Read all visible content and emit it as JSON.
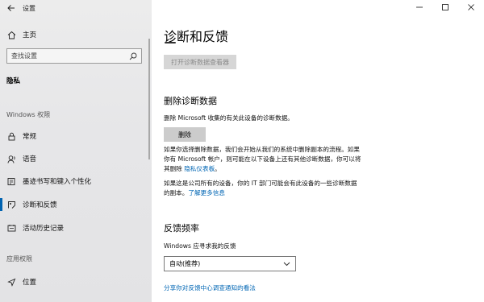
{
  "window": {
    "title": "设置",
    "controls": [
      "minimize",
      "maximize",
      "close"
    ]
  },
  "sidebar": {
    "home_label": "主页",
    "search_placeholder": "查找设置",
    "category_title": "隐私",
    "windows_permissions_label": "Windows 权限",
    "items": [
      {
        "label": "常规",
        "icon": "lock-icon"
      },
      {
        "label": "语音",
        "icon": "speech-icon"
      },
      {
        "label": "墨迹书写和键入个性化",
        "icon": "pen-keyboard-icon"
      },
      {
        "label": "诊断和反馈",
        "icon": "diagnostics-icon",
        "active": true
      },
      {
        "label": "活动历史记录",
        "icon": "history-icon"
      }
    ],
    "app_permissions_label": "应用权限",
    "app_items": [
      {
        "label": "位置",
        "icon": "location-icon"
      }
    ]
  },
  "main": {
    "title": "诊断和反馈",
    "open_viewer_button": "打开诊断数据查看器",
    "delete_section": {
      "heading": "删除诊断数据",
      "description": "删除 Microsoft 收集的有关此设备的诊断数据。",
      "delete_button": "删除",
      "note_line1": "如果你选择删除数据，我们会开始从我们的系统中删除副本的流程。如果",
      "note_line2": "你有 Microsoft 帐户，则可能在以下设备上还有其他诊断数据，你可以将",
      "note_line3_prefix": "其删除 ",
      "privacy_dashboard_link": "隐私仪表板",
      "note_line3_suffix": "。",
      "org_line1": "如果这是公司所有的设备，你的 IT 部门可能会有此设备的一些诊断数据",
      "org_line2_prefix": "的副本。",
      "learn_more_link": "了解更多信息"
    },
    "feedback_section": {
      "heading": "反馈频率",
      "ask_label": "Windows 应寻求我的反馈",
      "dropdown_value": "自动(推荐)",
      "share_link": "分享你对反馈中心调查通知的看法"
    }
  }
}
